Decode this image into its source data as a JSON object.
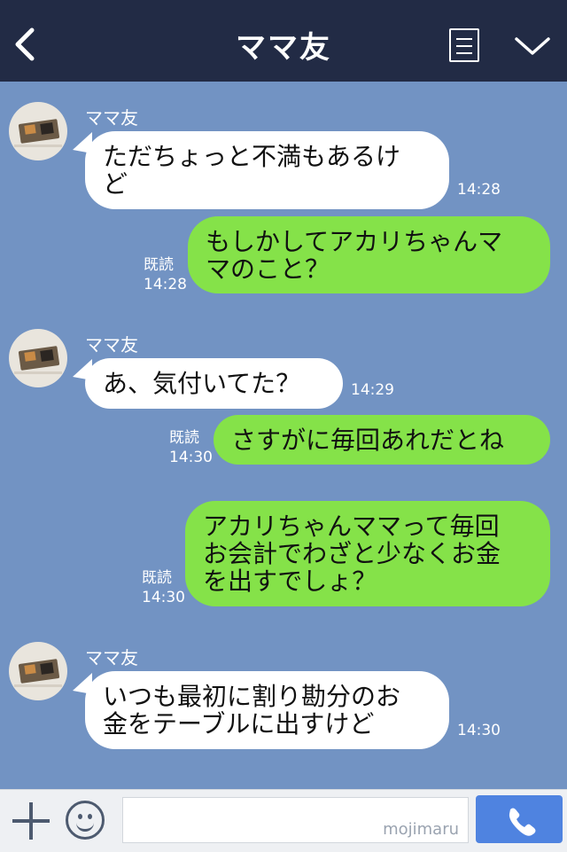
{
  "header": {
    "title": "ママ友"
  },
  "messages": [
    {
      "sender": "ママ友",
      "text": "ただちょっと不満もあるけ\nど",
      "time": "14:28"
    },
    {
      "read": "既読",
      "time": "14:28",
      "text": "もしかしてアカリちゃんマ\nマのこと？"
    },
    {
      "sender": "ママ友",
      "text": "あ、気付いてた？",
      "time": "14:29"
    },
    {
      "read": "既読",
      "time": "14:30",
      "text": "さすがに毎回あれだとね"
    },
    {
      "read": "既読",
      "time": "14:30",
      "text": "アカリちゃんママって毎回\nお会計でわざと少なくお金\nを出すでしょ？"
    },
    {
      "sender": "ママ友",
      "text": "いつも最初に割り勘分のお\n金をテーブルに出すけど",
      "time": "14:30"
    }
  ],
  "input": {
    "watermark": "mojimaru"
  },
  "colors": {
    "header": "#222b45",
    "background": "#7293c3",
    "outgoing": "#85e249",
    "incoming": "#ffffff",
    "send": "#4f83e0"
  }
}
